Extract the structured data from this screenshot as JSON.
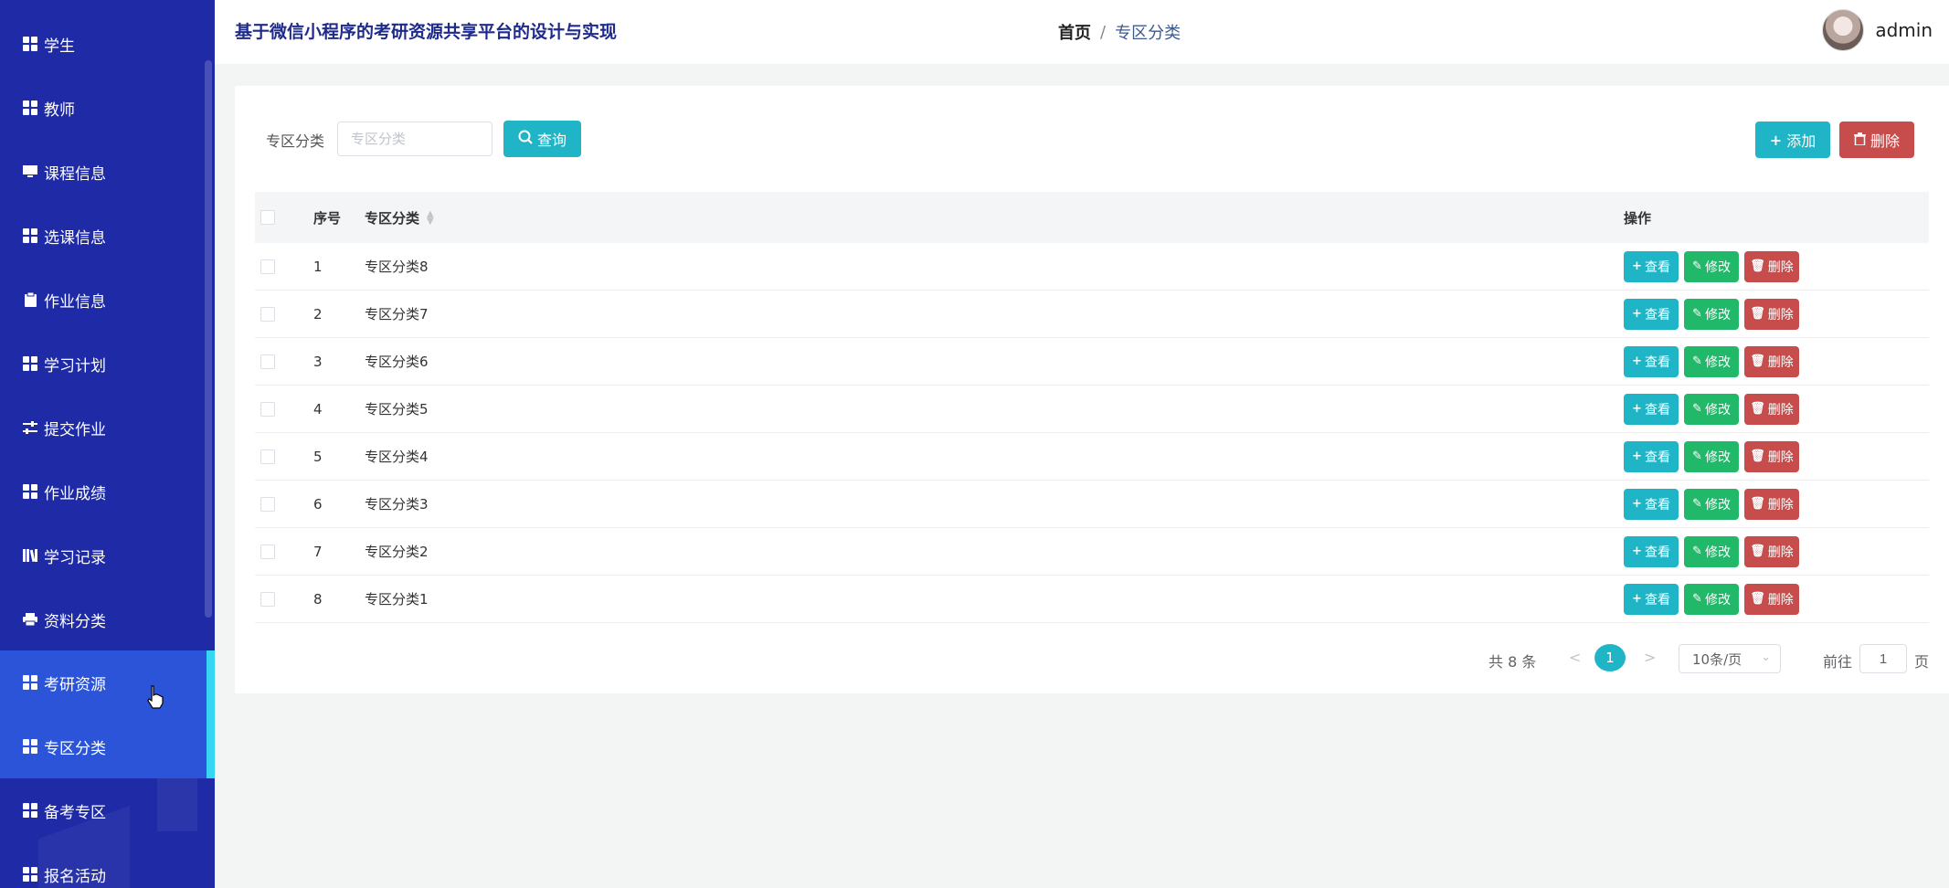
{
  "sidebar": {
    "items": [
      {
        "label": "学生",
        "icon": "grid-icon"
      },
      {
        "label": "教师",
        "icon": "grid-icon"
      },
      {
        "label": "课程信息",
        "icon": "monitor-icon"
      },
      {
        "label": "选课信息",
        "icon": "grid-icon"
      },
      {
        "label": "作业信息",
        "icon": "clipboard-icon"
      },
      {
        "label": "学习计划",
        "icon": "grid-icon"
      },
      {
        "label": "提交作业",
        "icon": "sliders-icon"
      },
      {
        "label": "作业成绩",
        "icon": "grid-icon"
      },
      {
        "label": "学习记录",
        "icon": "books-icon"
      },
      {
        "label": "资料分类",
        "icon": "print-icon"
      },
      {
        "label": "考研资源",
        "icon": "grid-icon"
      },
      {
        "label": "专区分类",
        "icon": "grid-icon"
      },
      {
        "label": "备考专区",
        "icon": "grid-icon"
      },
      {
        "label": "报名活动",
        "icon": "grid-icon"
      }
    ]
  },
  "header": {
    "title": "基于微信小程序的考研资源共享平台的设计与实现",
    "breadcrumb_home": "首页",
    "breadcrumb_sep": "/",
    "breadcrumb_current": "专区分类",
    "username": "admin"
  },
  "search": {
    "label": "专区分类",
    "placeholder": "专区分类",
    "query_label": "查询"
  },
  "toolbar": {
    "add_label": "添加",
    "delete_label": "删除"
  },
  "table": {
    "headers": {
      "index": "序号",
      "name": "专区分类",
      "ops": "操作"
    },
    "rows": [
      {
        "index": "1",
        "name": "专区分类8"
      },
      {
        "index": "2",
        "name": "专区分类7"
      },
      {
        "index": "3",
        "name": "专区分类6"
      },
      {
        "index": "4",
        "name": "专区分类5"
      },
      {
        "index": "5",
        "name": "专区分类4"
      },
      {
        "index": "6",
        "name": "专区分类3"
      },
      {
        "index": "7",
        "name": "专区分类2"
      },
      {
        "index": "8",
        "name": "专区分类1"
      }
    ],
    "op_labels": {
      "view": "查看",
      "edit": "修改",
      "delete": "删除"
    }
  },
  "pagination": {
    "total": "共 8 条",
    "prev": "<",
    "current_page": "1",
    "next": ">",
    "page_size": "10条/页",
    "goto_label": "前往",
    "goto_value": "1",
    "page_suffix": "页"
  },
  "colors": {
    "sidebar_bg": "#1e2aa6",
    "sidebar_active": "#2b54d8",
    "accent_cyan": "#1fb5c7",
    "edit_green": "#22b86a",
    "delete_red": "#c74c4c"
  }
}
